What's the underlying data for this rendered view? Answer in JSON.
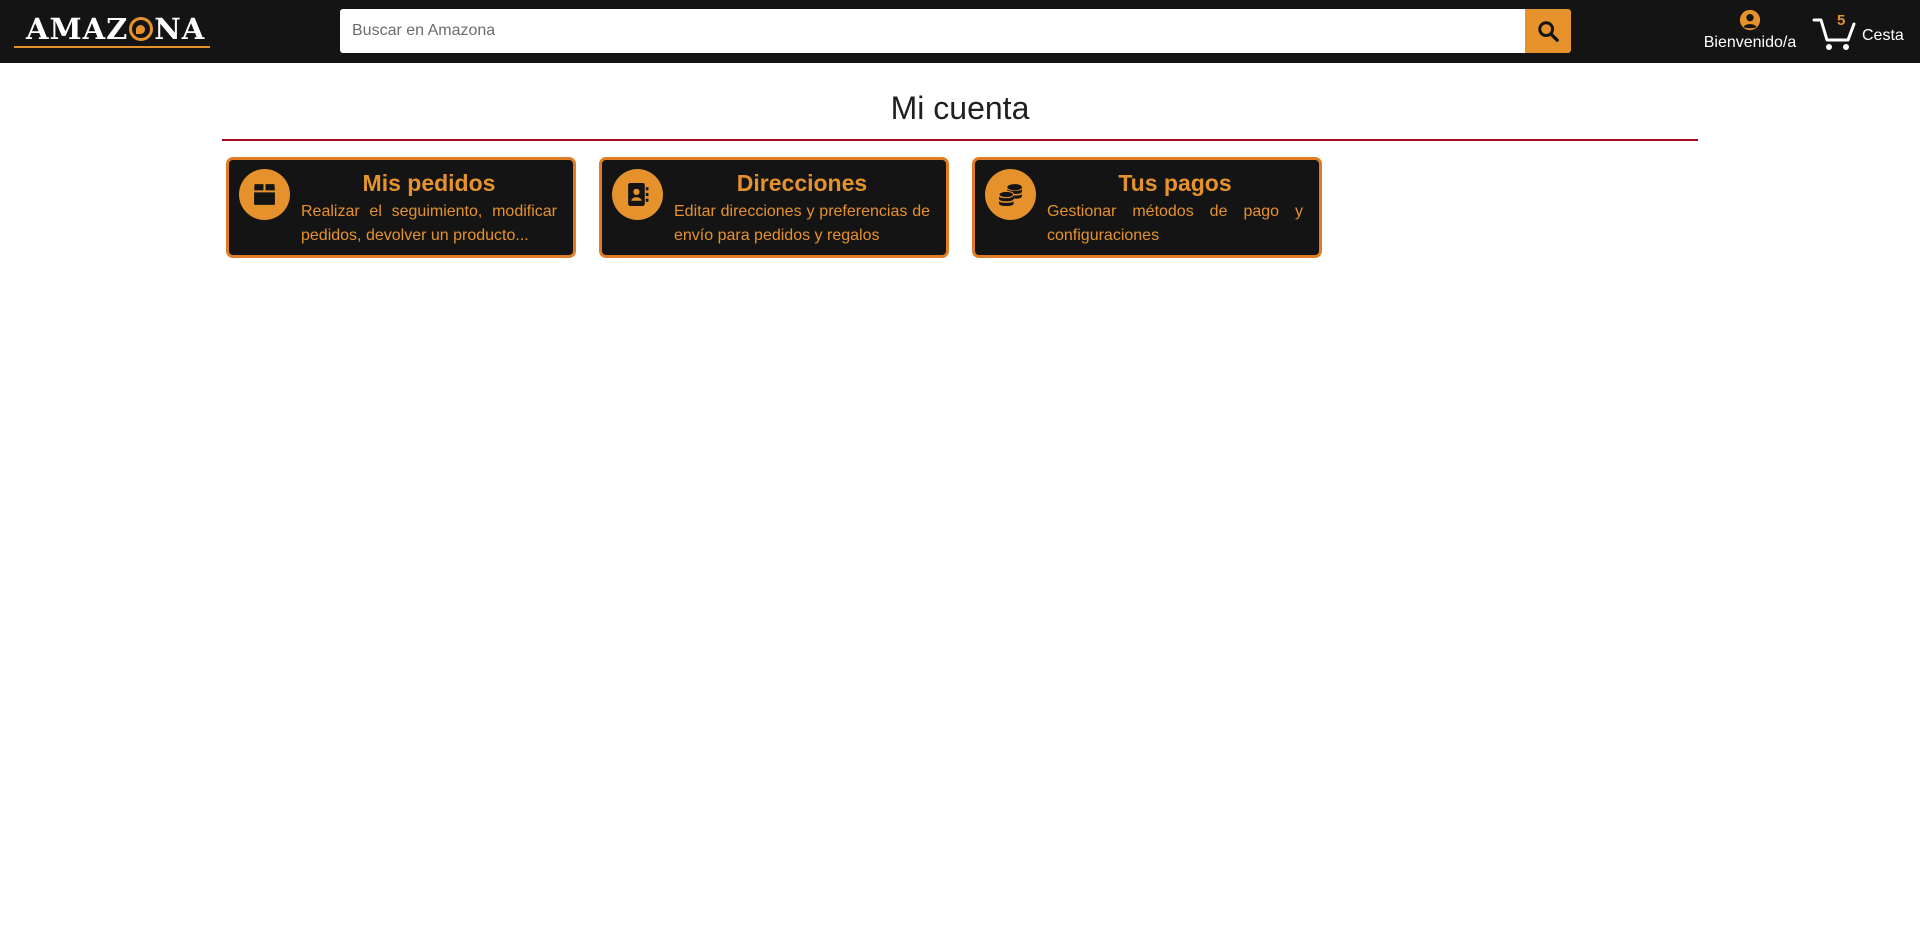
{
  "header": {
    "logo_text_before": "AMAZ",
    "logo_text_after": "NA",
    "search_placeholder": "Buscar en Amazona",
    "search_value": "",
    "account_label": "Bienvenido/a",
    "cart_count": "5",
    "cart_label": "Cesta"
  },
  "page": {
    "title": "Mi cuenta"
  },
  "cards": [
    {
      "icon": "box-icon",
      "title": "Mis pedidos",
      "description": "Realizar el seguimiento, modificar pedidos, devolver un producto..."
    },
    {
      "icon": "address-book-icon",
      "title": "Direcciones",
      "description": "Editar direcciones y preferencias de envío para pedidos y regalos"
    },
    {
      "icon": "coins-icon",
      "title": "Tus pagos",
      "description": "Gestionar métodos de pago y configuraciones"
    }
  ],
  "colors": {
    "header_bg": "#141414",
    "accent": "#e6922c",
    "card_border": "#e07d24",
    "title_rule": "#a50d1c"
  }
}
